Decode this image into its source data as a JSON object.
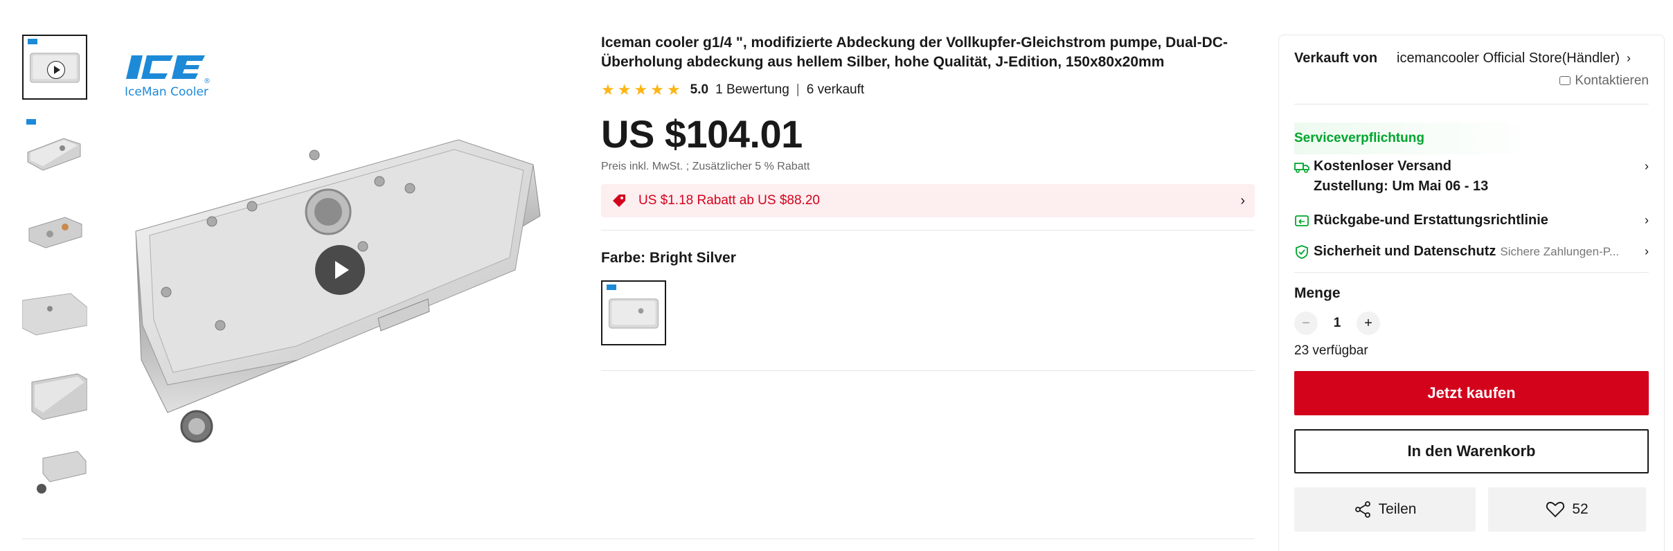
{
  "gallery": {
    "thumbnail_count": 6,
    "active_index": 0,
    "brand_logo_text": "IceMan Cooler"
  },
  "product": {
    "title": "Iceman cooler g1/4 \", modifizierte Abdeckung der Vollkupfer-Gleichstrom pumpe, Dual-DC-Überholung abdeckung aus hellem Silber, hohe Qualität, J-Edition, 150x80x20mm",
    "rating": "5.0",
    "stars": 5,
    "reviews": "1 Bewertung",
    "sold": "6 verkauft",
    "price": "US $104.01",
    "tax_note": "Preis inkl. MwSt. ; Zusätzlicher 5 % Rabatt",
    "discount_text": "US $1.18 Rabatt ab US $88.20",
    "color_label": "Farbe: Bright Silver"
  },
  "panel": {
    "seller_label": "Verkauft von",
    "seller_name": "icemancooler Official Store(Händler)",
    "contact": "Kontaktieren",
    "service_heading": "Serviceverpflichtung",
    "shipping": "Kostenloser Versand",
    "delivery": "Zustellung: Um Mai 06 - 13",
    "returns": "Rückgabe-und Erstattungsrichtlinie",
    "security": "Sicherheit und Datenschutz",
    "security_sub": "Sichere Zahlungen-P...",
    "qty_label": "Menge",
    "qty_value": "1",
    "available": "23 verfügbar",
    "buy_now": "Jetzt kaufen",
    "add_to_cart": "In den Warenkorb",
    "share": "Teilen",
    "wishlist_count": "52"
  },
  "colors": {
    "accent_red": "#d3031c",
    "service_green": "#00a52e",
    "star_gold": "#fdb515",
    "brand_blue": "#1d8ad8"
  }
}
